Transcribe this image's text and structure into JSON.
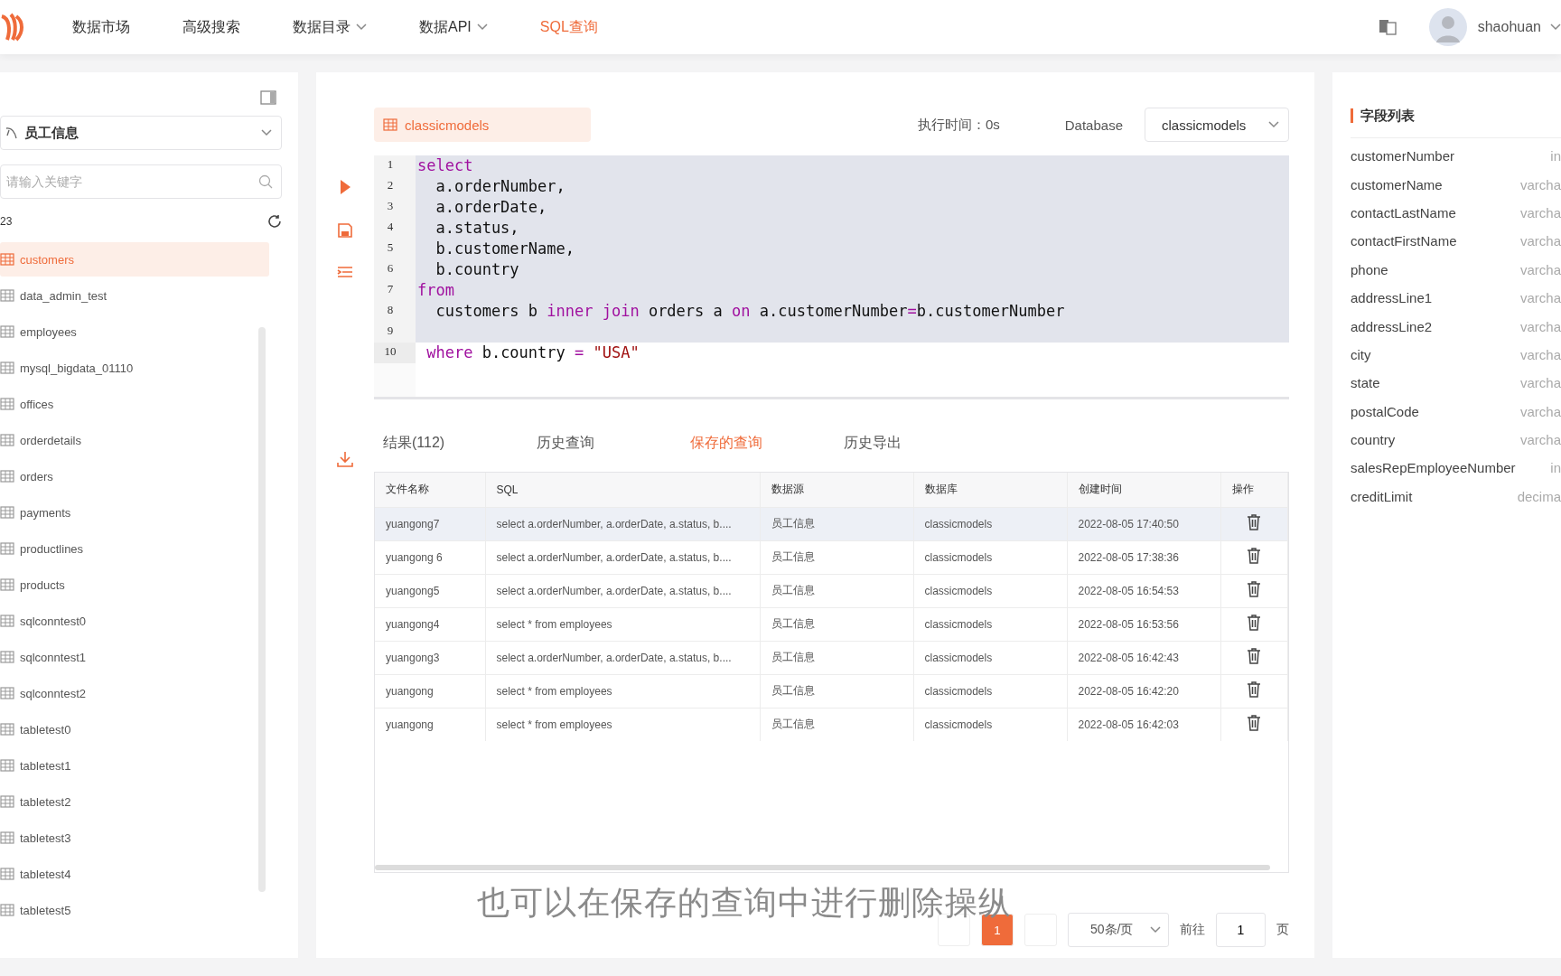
{
  "nav": {
    "items": [
      {
        "label": "数据市场",
        "dropdown": false,
        "selected": false
      },
      {
        "label": "高级搜索",
        "dropdown": false,
        "selected": false
      },
      {
        "label": "数据目录",
        "dropdown": true,
        "selected": false
      },
      {
        "label": "数据API",
        "dropdown": true,
        "selected": false
      },
      {
        "label": "SQL查询",
        "dropdown": false,
        "selected": true
      }
    ],
    "user": "shaohuan"
  },
  "sidebar": {
    "datasource": "员工信息",
    "search_placeholder": "请输入关键字",
    "count": "23",
    "tables": [
      {
        "name": "customers",
        "selected": true
      },
      {
        "name": "data_admin_test",
        "selected": false
      },
      {
        "name": "employees",
        "selected": false
      },
      {
        "name": "mysql_bigdata_01110",
        "selected": false
      },
      {
        "name": "offices",
        "selected": false
      },
      {
        "name": "orderdetails",
        "selected": false
      },
      {
        "name": "orders",
        "selected": false
      },
      {
        "name": "payments",
        "selected": false
      },
      {
        "name": "productlines",
        "selected": false
      },
      {
        "name": "products",
        "selected": false
      },
      {
        "name": "sqlconntest0",
        "selected": false
      },
      {
        "name": "sqlconntest1",
        "selected": false
      },
      {
        "name": "sqlconntest2",
        "selected": false
      },
      {
        "name": "tabletest0",
        "selected": false
      },
      {
        "name": "tabletest1",
        "selected": false
      },
      {
        "name": "tabletest2",
        "selected": false
      },
      {
        "name": "tabletest3",
        "selected": false
      },
      {
        "name": "tabletest4",
        "selected": false
      },
      {
        "name": "tabletest5",
        "selected": false
      }
    ]
  },
  "editor": {
    "table_tag": "classicmodels",
    "exec_time": "执行时间：0s",
    "database_label": "Database",
    "database": "classicmodels",
    "lines": [
      {
        "number": "1",
        "selected": true,
        "tokens": [
          {
            "kind": "kw",
            "text": "select"
          }
        ]
      },
      {
        "number": "2",
        "selected": true,
        "tokens": [
          {
            "kind": "plain",
            "text": "  a.orderNumber,"
          }
        ]
      },
      {
        "number": "3",
        "selected": true,
        "tokens": [
          {
            "kind": "plain",
            "text": "  a.orderDate,"
          }
        ]
      },
      {
        "number": "4",
        "selected": true,
        "tokens": [
          {
            "kind": "plain",
            "text": "  a.status,"
          }
        ]
      },
      {
        "number": "5",
        "selected": true,
        "tokens": [
          {
            "kind": "plain",
            "text": "  b.customerName,"
          }
        ]
      },
      {
        "number": "6",
        "selected": true,
        "tokens": [
          {
            "kind": "plain",
            "text": "  b.country"
          }
        ]
      },
      {
        "number": "7",
        "selected": true,
        "tokens": [
          {
            "kind": "kw",
            "text": "from"
          }
        ]
      },
      {
        "number": "8",
        "selected": true,
        "tokens": [
          {
            "kind": "plain",
            "text": "  customers b "
          },
          {
            "kind": "kw",
            "text": "inner join"
          },
          {
            "kind": "plain",
            "text": " orders a "
          },
          {
            "kind": "kw",
            "text": "on"
          },
          {
            "kind": "plain",
            "text": " a.customerNumber"
          },
          {
            "kind": "kw",
            "text": "="
          },
          {
            "kind": "plain",
            "text": "b.customerNumber"
          }
        ]
      },
      {
        "number": "9",
        "selected": true
      },
      {
        "number": "10",
        "selected": false,
        "tokens": [
          {
            "kind": "kw",
            "text": " where"
          },
          {
            "kind": "plain",
            "text": " b.country "
          },
          {
            "kind": "kw",
            "text": "="
          },
          {
            "kind": "str",
            "text": " \"USA\""
          }
        ]
      }
    ]
  },
  "result_tabs": [
    {
      "label": "结果(112)",
      "selected": false
    },
    {
      "label": "历史查询",
      "selected": false
    },
    {
      "label": "保存的查询",
      "selected": true
    },
    {
      "label": "历史导出",
      "selected": false
    }
  ],
  "table": {
    "columns": [
      "文件名称",
      "SQL",
      "数据源",
      "数据库",
      "创建时间",
      "操作"
    ],
    "rows": [
      {
        "highlighted": true,
        "cells": [
          "yuangong7",
          "select a.orderNumber, a.orderDate, a.status, b....",
          "员工信息",
          "classicmodels",
          "2022-08-05 17:40:50"
        ]
      },
      {
        "highlighted": false,
        "cells": [
          "yuangong 6",
          "select a.orderNumber, a.orderDate, a.status, b....",
          "员工信息",
          "classicmodels",
          "2022-08-05 17:38:36"
        ]
      },
      {
        "highlighted": false,
        "cells": [
          "yuangong5",
          "select a.orderNumber, a.orderDate, a.status, b....",
          "员工信息",
          "classicmodels",
          "2022-08-05 16:54:53"
        ]
      },
      {
        "highlighted": false,
        "cells": [
          "yuangong4",
          "select * from employees",
          "员工信息",
          "classicmodels",
          "2022-08-05 16:53:56"
        ]
      },
      {
        "highlighted": false,
        "cells": [
          "yuangong3",
          "select a.orderNumber, a.orderDate, a.status, b....",
          "员工信息",
          "classicmodels",
          "2022-08-05 16:42:43"
        ]
      },
      {
        "highlighted": false,
        "cells": [
          "yuangong",
          "select * from employees",
          "员工信息",
          "classicmodels",
          "2022-08-05 16:42:20"
        ]
      },
      {
        "highlighted": false,
        "cells": [
          "yuangong",
          "select * from employees",
          "员工信息",
          "classicmodels",
          "2022-08-05 16:42:03"
        ]
      }
    ]
  },
  "pagination": {
    "pages": [
      {
        "label": "1",
        "selected": true
      }
    ],
    "page_size": "50条/页",
    "goto_label": "前往",
    "goto_value": "1",
    "page_unit": "页"
  },
  "subtitle": "也可以在保存的查询中进行删除操纵",
  "fields": {
    "title": "字段列表",
    "items": [
      {
        "name": "customerNumber",
        "type": "in"
      },
      {
        "name": "customerName",
        "type": "varcha"
      },
      {
        "name": "contactLastName",
        "type": "varcha"
      },
      {
        "name": "contactFirstName",
        "type": "varcha"
      },
      {
        "name": "phone",
        "type": "varcha"
      },
      {
        "name": "addressLine1",
        "type": "varcha"
      },
      {
        "name": "addressLine2",
        "type": "varcha"
      },
      {
        "name": "city",
        "type": "varcha"
      },
      {
        "name": "state",
        "type": "varcha"
      },
      {
        "name": "postalCode",
        "type": "varcha"
      },
      {
        "name": "country",
        "type": "varcha"
      },
      {
        "name": "salesRepEmployeeNumber",
        "type": "in"
      },
      {
        "name": "creditLimit",
        "type": "decima"
      }
    ]
  }
}
